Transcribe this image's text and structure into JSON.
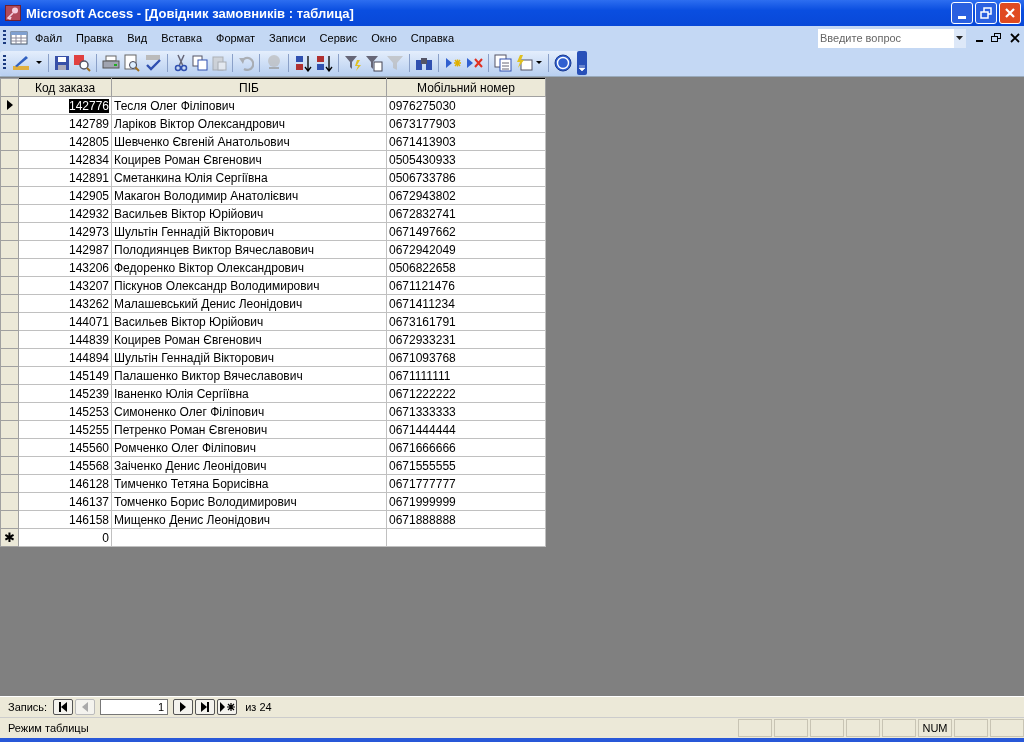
{
  "window": {
    "title": "Microsoft Access - [Довідник замовників : таблица]"
  },
  "menu": [
    "Файл",
    "Правка",
    "Вид",
    "Вставка",
    "Формат",
    "Записи",
    "Сервис",
    "Окно",
    "Справка"
  ],
  "help_search": {
    "placeholder": "Введите вопрос"
  },
  "table": {
    "columns": [
      "Код заказа",
      "ПІБ",
      "Мобільний номер"
    ],
    "rows": [
      {
        "selected": true,
        "cells": [
          "142776",
          "Тесля Олег Філіпович",
          "0976275030"
        ]
      },
      {
        "selected": false,
        "cells": [
          "142789",
          "Ларіков Віктор Олександрович",
          "0673177903"
        ]
      },
      {
        "selected": false,
        "cells": [
          "142805",
          "Шевченко Євгеній  Анатольович",
          "0671413903"
        ]
      },
      {
        "selected": false,
        "cells": [
          "142834",
          "Коцирев Роман Євгенович",
          "0505430933"
        ]
      },
      {
        "selected": false,
        "cells": [
          "142891",
          "Сметанкина  Юлія Сергіївна",
          "0506733786"
        ]
      },
      {
        "selected": false,
        "cells": [
          "142905",
          "Макагон Володимир Анатолієвич",
          "0672943802"
        ]
      },
      {
        "selected": false,
        "cells": [
          "142932",
          "Васильев Віктор Юрійович",
          "0672832741"
        ]
      },
      {
        "selected": false,
        "cells": [
          "142973",
          "Шультін Геннадій Вікторович",
          "0671497662"
        ]
      },
      {
        "selected": false,
        "cells": [
          "142987",
          "Полодиянцев Виктор Вячеславович",
          "0672942049"
        ]
      },
      {
        "selected": false,
        "cells": [
          "143206",
          "Федоренко Віктор Олександрович",
          "0506822658"
        ]
      },
      {
        "selected": false,
        "cells": [
          "143207",
          "Піскунов Олександр Володимирович",
          "0671121476"
        ]
      },
      {
        "selected": false,
        "cells": [
          "143262",
          "Малашевський Денис Леонідович",
          "0671411234"
        ]
      },
      {
        "selected": false,
        "cells": [
          "144071",
          "Васильев Віктор Юрійович",
          "0673161791"
        ]
      },
      {
        "selected": false,
        "cells": [
          "144839",
          "Коцирев Роман Євгенович",
          "0672933231"
        ]
      },
      {
        "selected": false,
        "cells": [
          "144894",
          "Шультін Геннадій Вікторович",
          "0671093768"
        ]
      },
      {
        "selected": false,
        "cells": [
          "145149",
          "Палашенко Виктор Вячеславович",
          "0671111111"
        ]
      },
      {
        "selected": false,
        "cells": [
          "145239",
          "Іваненко Юлія Сергіївна",
          "0671222222"
        ]
      },
      {
        "selected": false,
        "cells": [
          "145253",
          "Симоненко Олег Філіпович",
          "0671333333"
        ]
      },
      {
        "selected": false,
        "cells": [
          "145255",
          "Петренко Роман Євгенович",
          "0671444444"
        ]
      },
      {
        "selected": false,
        "cells": [
          "145560",
          "Ромченко Олег Філіпович",
          "0671666666"
        ]
      },
      {
        "selected": false,
        "cells": [
          "145568",
          "Заіченко Денис Леонідович",
          "0671555555"
        ]
      },
      {
        "selected": false,
        "cells": [
          "146128",
          "Тимченко Тетяна Борисівна",
          "0671777777"
        ]
      },
      {
        "selected": false,
        "cells": [
          "146137",
          "Томченко Борис Володимирович",
          "0671999999"
        ]
      },
      {
        "selected": false,
        "cells": [
          "146158",
          "Мищенко Денис Леонідович",
          "0671888888"
        ]
      }
    ],
    "new_row": {
      "marker": "✱",
      "cells": [
        "0",
        "",
        ""
      ]
    }
  },
  "navigator": {
    "label": "Запись:",
    "current": "1",
    "total": "из 24",
    "first_disabled": false,
    "prev_disabled": true
  },
  "status_bar": {
    "mode": "Режим таблицы",
    "indicator": "NUM"
  }
}
